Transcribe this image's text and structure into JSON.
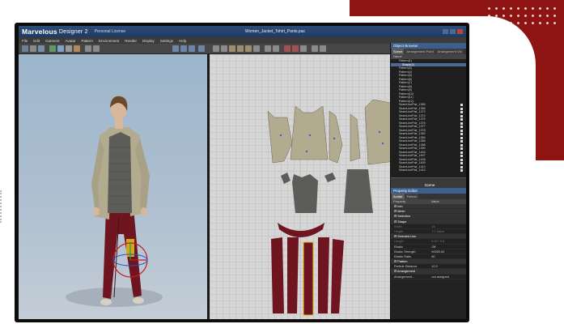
{
  "app": {
    "brand": "Marvelous",
    "brand_version": "Designer 2",
    "edition": "Personal License",
    "file_name": "Women_Jacket_Tshirt_Pants.pac"
  },
  "menu": [
    "File",
    "Edit",
    "Garment",
    "Avatar",
    "Pattern",
    "Environment",
    "Render",
    "Display",
    "Settings",
    "Help"
  ],
  "object_browser": {
    "title": "Object Browser",
    "tabs": [
      "Scene",
      "Arrangement Point",
      "Arrangement Vtx"
    ],
    "column": "Name",
    "items": [
      "Pattern(1)",
      "Shape(2)",
      "Pattern(3)",
      "Pattern(4)",
      "Pattern(5)",
      "Pattern(6)",
      "Pattern(7)",
      "Pattern(8)",
      "Pattern(9)",
      "Pattern(10)",
      "Pattern(11)",
      "Pattern(12)",
      "SeamLinePair_1365",
      "SeamLinePair_1366",
      "SeamLinePair_1372",
      "SeamLinePair_1374",
      "SeamLinePair_1375",
      "SeamLinePair_1376",
      "SeamLinePair_1377",
      "SeamLinePair_1378",
      "SeamLinePair_1382",
      "SeamLinePair_1384",
      "SeamLinePair_1386",
      "SeamLinePair_1388",
      "SeamLinePair_1390",
      "SeamLinePair_1404",
      "SeamLinePair_1407",
      "SeamLinePair_1408",
      "SeamLinePair_1409",
      "SeamLinePair_1410",
      "SeamLinePair_1413"
    ],
    "selected_index": 1,
    "footer": "Scene"
  },
  "property_editor": {
    "title": "Property Editor",
    "tabs": [
      "Avatar",
      "Pattern"
    ],
    "columns": [
      "Property",
      "Value"
    ],
    "rows": [
      {
        "name": "Info",
        "value": "",
        "section": true
      },
      {
        "name": "Mesh",
        "value": "",
        "section": true
      },
      {
        "name": "Selection",
        "value": "",
        "section": true
      },
      {
        "name": "Shape",
        "value": "",
        "section": true
      },
      {
        "name": "Width",
        "value": "15",
        "dim": true
      },
      {
        "name": "Height",
        "value": "7:7 Value",
        "dim": true
      },
      {
        "name": "Selected Line",
        "value": "",
        "section": true
      },
      {
        "name": "Length",
        "value": "5.92 / 3.8",
        "dim": true
      },
      {
        "name": "Elastic",
        "value": "Off"
      },
      {
        "name": "Elastic Strength",
        "value": "50000.00"
      },
      {
        "name": "Elastic Ratio",
        "value": "80"
      },
      {
        "name": "Pattern",
        "value": "",
        "section": true
      },
      {
        "name": "Particle Distance",
        "value": "10.0"
      },
      {
        "name": "Arrangement",
        "value": "",
        "section": true
      },
      {
        "name": "Arrangement...",
        "value": "not assigned"
      }
    ]
  },
  "colors": {
    "brand_red": "#8e1414",
    "title_blue": "#2d4c78",
    "fabric_jacket": "#b3ab90",
    "fabric_shirt": "#5c5c58",
    "fabric_pants": "#6e1520",
    "selection_yellow": "#e5c020"
  }
}
